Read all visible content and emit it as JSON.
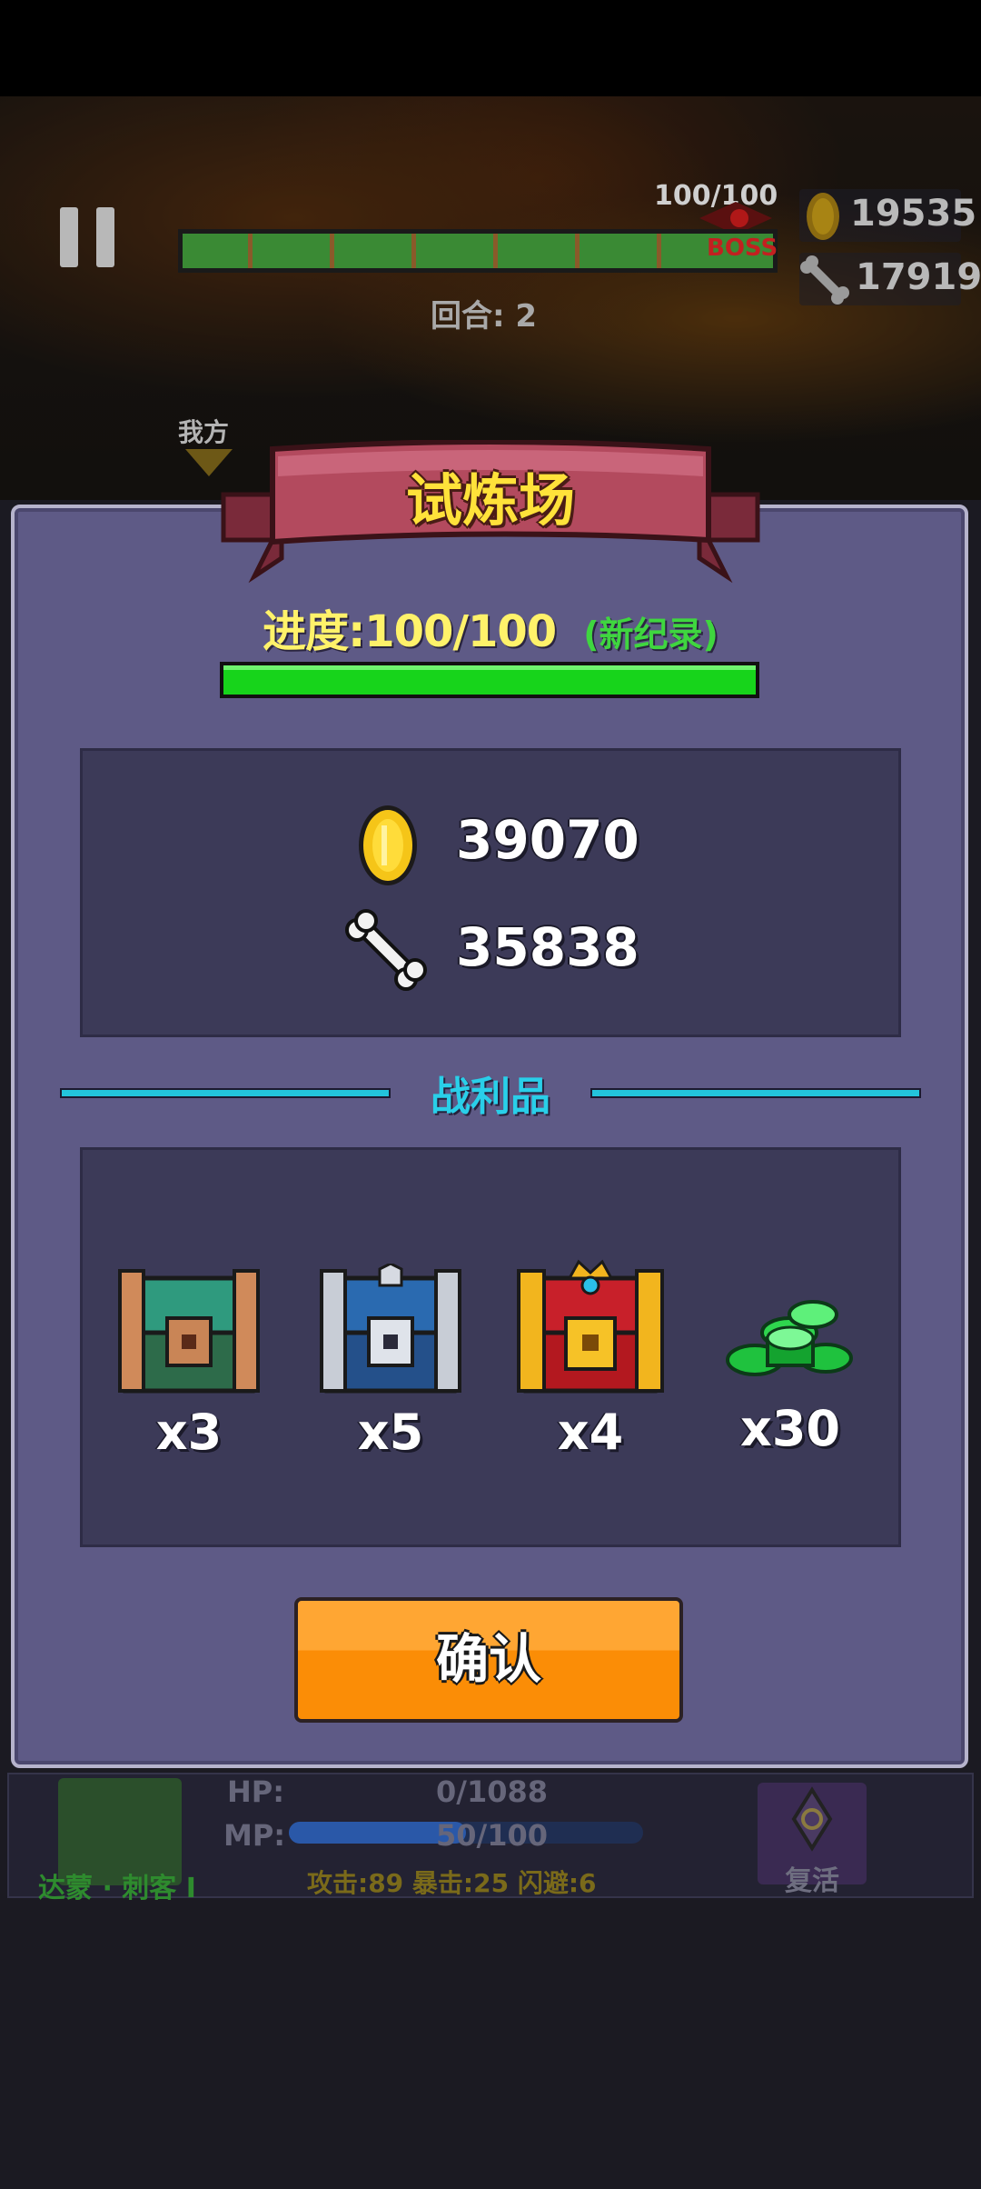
{
  "hud": {
    "boss_hp_text": "100/100",
    "boss_badge": "BOSS",
    "round_text": "回合: 2",
    "gold": "19535",
    "bones": "17919",
    "my_side_label": "我方",
    "boss_hp_fraction": 1.0
  },
  "modal": {
    "title": "试炼场",
    "progress_label": "进度:100/100",
    "record_label": "(新纪录)",
    "progress_fraction": 1.0,
    "rewards": {
      "gold": "39070",
      "bones": "35838"
    },
    "loot_title": "战利品",
    "loot": [
      {
        "icon": "green-treasure-chest-icon",
        "qty": "x3"
      },
      {
        "icon": "blue-silver-treasure-chest-icon",
        "qty": "x5"
      },
      {
        "icon": "golden-red-treasure-chest-icon",
        "qty": "x4"
      },
      {
        "icon": "green-gems-icon",
        "qty": "x30"
      }
    ],
    "confirm_label": "确认"
  },
  "character": {
    "hp_label": "HP:",
    "hp_value": "0/1088",
    "mp_label": "MP:",
    "mp_value": "50/100",
    "mp_fraction": 0.5,
    "name": "达蒙 · 刺客 I",
    "stats": "攻击:89 暴击:25 闪避:6",
    "revive_label": "复活"
  },
  "colors": {
    "gold": "#f5c518",
    "progress_green": "#17d41b",
    "title_yellow": "#ffe23a",
    "loot_cyan": "#29cfe9",
    "confirm_orange": "#fb8d06",
    "modal_bg": "#5e5a86"
  }
}
